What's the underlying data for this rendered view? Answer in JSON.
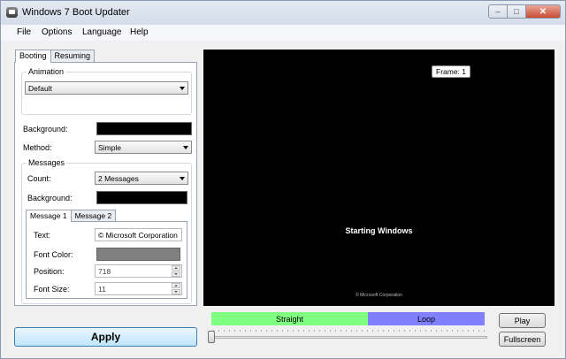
{
  "window": {
    "title": "Windows 7 Boot Updater",
    "caption": {
      "minimize": "–",
      "maximize": "□",
      "close": "✕"
    }
  },
  "menu": [
    "File",
    "Options",
    "Language",
    "Help"
  ],
  "tabs": [
    "Booting",
    "Resuming"
  ],
  "animation": {
    "group_label": "Animation",
    "selected": "Default"
  },
  "background_label": "Background:",
  "background_color": "#000000",
  "method_label": "Method:",
  "method_value": "Simple",
  "messages": {
    "group_label": "Messages",
    "count_label": "Count:",
    "count_value": "2 Messages",
    "background_label": "Background:",
    "background_color": "#000000",
    "tabs": [
      "Message 1",
      "Message 2"
    ],
    "text_label": "Text:",
    "text_value": "© Microsoft Corporation",
    "font_color_label": "Font Color:",
    "font_color": "#808080",
    "position_label": "Position:",
    "position_value": "718",
    "font_size_label": "Font Size:",
    "font_size_value": "11"
  },
  "apply_label": "Apply",
  "preview": {
    "frame_label": "Frame: 1",
    "main_text": "Starting Windows",
    "copyright_text": "© Microsoft Corporation"
  },
  "timeline": {
    "straight_label": "Straight",
    "straight_color": "#80ff80",
    "loop_label": "Loop",
    "loop_color": "#8080ff"
  },
  "buttons": {
    "play": "Play",
    "fullscreen": "Fullscreen"
  }
}
